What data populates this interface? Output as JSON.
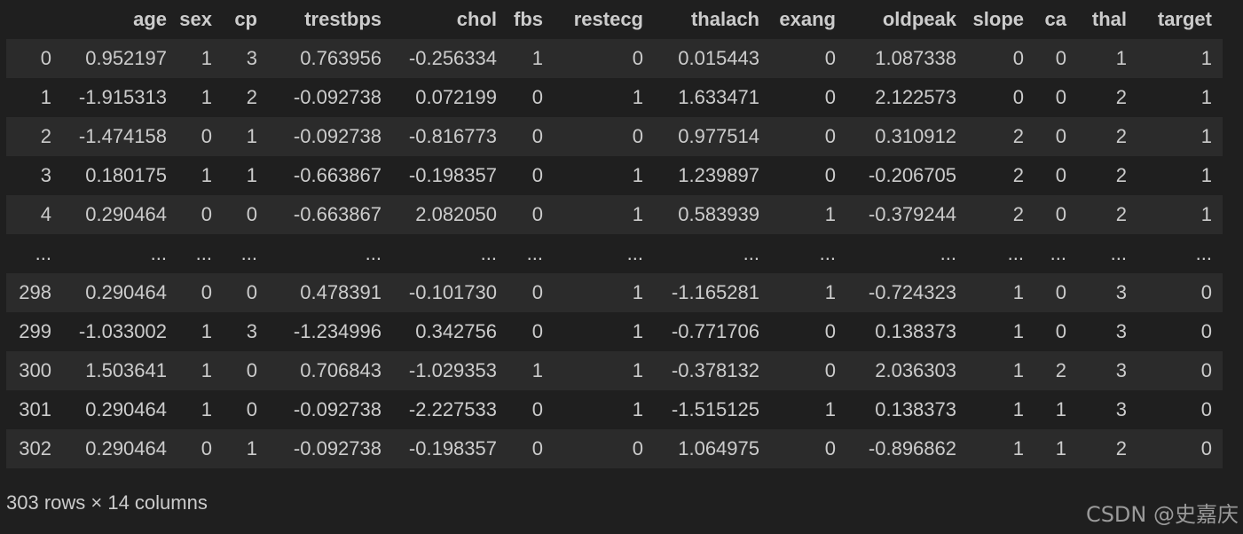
{
  "table": {
    "columns": [
      "",
      "age",
      "sex",
      "cp",
      "trestbps",
      "chol",
      "fbs",
      "restecg",
      "thalach",
      "exang",
      "oldpeak",
      "slope",
      "ca",
      "thal",
      "target"
    ],
    "rows": [
      [
        "0",
        "0.952197",
        "1",
        "3",
        "0.763956",
        "-0.256334",
        "1",
        "0",
        "0.015443",
        "0",
        "1.087338",
        "0",
        "0",
        "1",
        "1"
      ],
      [
        "1",
        "-1.915313",
        "1",
        "2",
        "-0.092738",
        "0.072199",
        "0",
        "1",
        "1.633471",
        "0",
        "2.122573",
        "0",
        "0",
        "2",
        "1"
      ],
      [
        "2",
        "-1.474158",
        "0",
        "1",
        "-0.092738",
        "-0.816773",
        "0",
        "0",
        "0.977514",
        "0",
        "0.310912",
        "2",
        "0",
        "2",
        "1"
      ],
      [
        "3",
        "0.180175",
        "1",
        "1",
        "-0.663867",
        "-0.198357",
        "0",
        "1",
        "1.239897",
        "0",
        "-0.206705",
        "2",
        "0",
        "2",
        "1"
      ],
      [
        "4",
        "0.290464",
        "0",
        "0",
        "-0.663867",
        "2.082050",
        "0",
        "1",
        "0.583939",
        "1",
        "-0.379244",
        "2",
        "0",
        "2",
        "1"
      ],
      [
        "...",
        "...",
        "...",
        "...",
        "...",
        "...",
        "...",
        "...",
        "...",
        "...",
        "...",
        "...",
        "...",
        "...",
        "..."
      ],
      [
        "298",
        "0.290464",
        "0",
        "0",
        "0.478391",
        "-0.101730",
        "0",
        "1",
        "-1.165281",
        "1",
        "-0.724323",
        "1",
        "0",
        "3",
        "0"
      ],
      [
        "299",
        "-1.033002",
        "1",
        "3",
        "-1.234996",
        "0.342756",
        "0",
        "1",
        "-0.771706",
        "0",
        "0.138373",
        "1",
        "0",
        "3",
        "0"
      ],
      [
        "300",
        "1.503641",
        "1",
        "0",
        "0.706843",
        "-1.029353",
        "1",
        "1",
        "-0.378132",
        "0",
        "2.036303",
        "1",
        "2",
        "3",
        "0"
      ],
      [
        "301",
        "0.290464",
        "1",
        "0",
        "-0.092738",
        "-2.227533",
        "0",
        "1",
        "-1.515125",
        "1",
        "0.138373",
        "1",
        "1",
        "3",
        "0"
      ],
      [
        "302",
        "0.290464",
        "0",
        "1",
        "-0.092738",
        "-0.198357",
        "0",
        "0",
        "1.064975",
        "0",
        "-0.896862",
        "1",
        "1",
        "2",
        "0"
      ]
    ]
  },
  "caption": "303 rows × 14 columns",
  "watermark": "CSDN @史嘉庆"
}
